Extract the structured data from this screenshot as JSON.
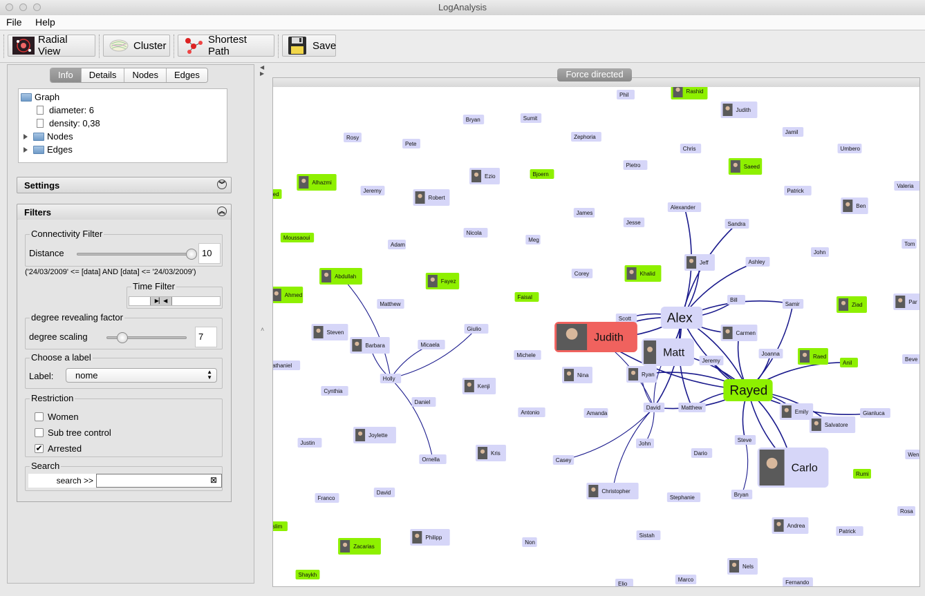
{
  "window": {
    "title": "LogAnalysis"
  },
  "menu": {
    "file": "File",
    "help": "Help"
  },
  "toolbar": {
    "radial_view": "Radial View",
    "cluster": "Cluster",
    "shortest_path": "Shortest Path",
    "save": "Save"
  },
  "tabs": [
    "Info",
    "Details",
    "Nodes",
    "Edges"
  ],
  "tree": {
    "root": "Graph",
    "diameter": "diameter: 6",
    "density": "density: 0,38",
    "nodes": "Nodes",
    "edges": "Edges"
  },
  "settings": {
    "label": "Settings"
  },
  "filters": {
    "label": "Filters",
    "connectivity_title": "Connectivity Filter",
    "distance_label": "Distance",
    "distance_value": "10",
    "distance_fraction": 1.0,
    "date_expr": "('24/03/2009' <= [data] AND [data] <= '24/03/2009')",
    "time_filter_title": "Time Filter",
    "degree_title": "degree revealing factor",
    "degree_label": "degree scaling",
    "degree_value": "7",
    "degree_fraction": 0.2,
    "label_title": "Choose a label",
    "label_label": "Label:",
    "label_selected": "nome",
    "restriction_title": "Restriction",
    "women": "Women",
    "women_checked": false,
    "subtree": "Sub tree control",
    "subtree_checked": false,
    "arrested": "Arrested",
    "arrested_checked": true,
    "search_title": "Search",
    "search_label": "search >>",
    "search_value": ""
  },
  "canvas": {
    "tab": "Force directed"
  },
  "colors": {
    "node_default": "#d6d6f8",
    "node_arrested": "#8ef000",
    "node_selected": "#f0625e",
    "edge": "#1a1a8c"
  },
  "graph": {
    "nodes": [
      {
        "name": "Phil",
        "type": "plain"
      },
      {
        "name": "Rashid",
        "type": "arrested",
        "photo": true
      },
      {
        "name": "Judith",
        "type": "plain",
        "photo": true
      },
      {
        "name": "Bryan",
        "type": "plain"
      },
      {
        "name": "Sumit",
        "type": "plain"
      },
      {
        "name": "Zephoria",
        "type": "plain"
      },
      {
        "name": "Jamil",
        "type": "plain"
      },
      {
        "name": "Rosy",
        "type": "plain"
      },
      {
        "name": "Pete",
        "type": "plain"
      },
      {
        "name": "Chris",
        "type": "plain"
      },
      {
        "name": "Umbero",
        "type": "plain"
      },
      {
        "name": "Pietro",
        "type": "plain"
      },
      {
        "name": "Saeed",
        "type": "arrested",
        "photo": true
      },
      {
        "name": "Ezio",
        "type": "plain",
        "photo": true
      },
      {
        "name": "Bjoern",
        "type": "arrested"
      },
      {
        "name": "Alhazmi",
        "type": "arrested",
        "photo": true
      },
      {
        "name": "Jeremy",
        "type": "plain"
      },
      {
        "name": "Robert",
        "type": "plain",
        "photo": true
      },
      {
        "name": "Patrick",
        "type": "plain"
      },
      {
        "name": "Valeria",
        "type": "plain"
      },
      {
        "name": "Ben",
        "type": "plain",
        "photo": true
      },
      {
        "name": "Alexander",
        "type": "plain"
      },
      {
        "name": "James",
        "type": "plain"
      },
      {
        "name": "Jesse",
        "type": "plain"
      },
      {
        "name": "Sandra",
        "type": "plain"
      },
      {
        "name": "Moussaoui",
        "type": "arrested"
      },
      {
        "name": "Nicola",
        "type": "plain"
      },
      {
        "name": "Meg",
        "type": "plain"
      },
      {
        "name": "Adam",
        "type": "plain"
      },
      {
        "name": "Tom",
        "type": "plain"
      },
      {
        "name": "John",
        "type": "plain"
      },
      {
        "name": "Jeff",
        "type": "plain",
        "photo": true
      },
      {
        "name": "Ashley",
        "type": "plain"
      },
      {
        "name": "Abdullah",
        "type": "arrested",
        "photo": true
      },
      {
        "name": "Fayez",
        "type": "arrested",
        "photo": true
      },
      {
        "name": "Corey",
        "type": "plain"
      },
      {
        "name": "Khalid",
        "type": "arrested",
        "photo": true
      },
      {
        "name": "Ahmed",
        "type": "arrested",
        "photo": true
      },
      {
        "name": "Matthew",
        "type": "plain"
      },
      {
        "name": "Faisal",
        "type": "arrested"
      },
      {
        "name": "Bill",
        "type": "plain"
      },
      {
        "name": "Samir",
        "type": "plain"
      },
      {
        "name": "Ziad",
        "type": "arrested",
        "photo": true
      },
      {
        "name": "Scott",
        "type": "plain"
      },
      {
        "name": "Alex",
        "type": "plain",
        "big": true
      },
      {
        "name": "Steven",
        "type": "plain",
        "photo": true
      },
      {
        "name": "Giulio",
        "type": "plain"
      },
      {
        "name": "Barbara",
        "type": "plain",
        "photo": true
      },
      {
        "name": "Micaela",
        "type": "plain"
      },
      {
        "name": "Judith",
        "type": "selected",
        "photo": true,
        "big": true
      },
      {
        "name": "Carmen",
        "type": "plain",
        "photo": true
      },
      {
        "name": "Matt",
        "type": "plain",
        "photo": true,
        "big": true
      },
      {
        "name": "Joanna",
        "type": "plain"
      },
      {
        "name": "Raed",
        "type": "arrested",
        "photo": true
      },
      {
        "name": "Michele",
        "type": "plain"
      },
      {
        "name": "Jeremy",
        "type": "plain"
      },
      {
        "name": "Anil",
        "type": "arrested"
      },
      {
        "name": "Nathaniel",
        "type": "plain"
      },
      {
        "name": "Holly",
        "type": "plain"
      },
      {
        "name": "Nina",
        "type": "plain",
        "photo": true
      },
      {
        "name": "Ryan",
        "type": "plain",
        "photo": true
      },
      {
        "name": "Rayed",
        "type": "arrested",
        "big": true
      },
      {
        "name": "Kenji",
        "type": "plain",
        "photo": true
      },
      {
        "name": "Cynthia",
        "type": "plain"
      },
      {
        "name": "Daniel",
        "type": "plain"
      },
      {
        "name": "David",
        "type": "plain"
      },
      {
        "name": "Matthew",
        "type": "plain"
      },
      {
        "name": "Emily",
        "type": "plain",
        "photo": true
      },
      {
        "name": "Gianluca",
        "type": "plain"
      },
      {
        "name": "Antonio",
        "type": "plain"
      },
      {
        "name": "Amanda",
        "type": "plain"
      },
      {
        "name": "Salvatore",
        "type": "plain",
        "photo": true
      },
      {
        "name": "Joylette",
        "type": "plain",
        "photo": true
      },
      {
        "name": "Justin",
        "type": "plain"
      },
      {
        "name": "Steve",
        "type": "plain"
      },
      {
        "name": "Kris",
        "type": "plain",
        "photo": true
      },
      {
        "name": "Ornella",
        "type": "plain"
      },
      {
        "name": "John",
        "type": "plain"
      },
      {
        "name": "Casey",
        "type": "plain"
      },
      {
        "name": "Dario",
        "type": "plain"
      },
      {
        "name": "Carlo",
        "type": "plain",
        "photo": true,
        "big": true
      },
      {
        "name": "Rumi",
        "type": "arrested"
      },
      {
        "name": "Franco",
        "type": "plain"
      },
      {
        "name": "David",
        "type": "plain"
      },
      {
        "name": "Christopher",
        "type": "plain",
        "photo": true
      },
      {
        "name": "Stephanie",
        "type": "plain"
      },
      {
        "name": "Bryan",
        "type": "plain"
      },
      {
        "name": "Rosa",
        "type": "plain"
      },
      {
        "name": "Andrea",
        "type": "plain",
        "photo": true
      },
      {
        "name": "Patrick",
        "type": "plain"
      },
      {
        "name": "Philipp",
        "type": "plain",
        "photo": true
      },
      {
        "name": "Sistah",
        "type": "plain"
      },
      {
        "name": "Zacarias",
        "type": "arrested",
        "photo": true
      },
      {
        "name": "Non",
        "type": "plain"
      },
      {
        "name": "Nels",
        "type": "plain",
        "photo": true
      },
      {
        "name": "Shaykh",
        "type": "arrested"
      },
      {
        "name": "Marco",
        "type": "plain"
      },
      {
        "name": "Fernando",
        "type": "plain"
      },
      {
        "name": "Wen",
        "type": "plain"
      },
      {
        "name": "Beve",
        "type": "plain"
      },
      {
        "name": "Par",
        "type": "plain",
        "photo": true
      },
      {
        "name": "Elio",
        "type": "plain"
      },
      {
        "name": "athaniel",
        "type": "plain"
      },
      {
        "name": "slim",
        "type": "arrested"
      },
      {
        "name": "ed",
        "type": "arrested"
      }
    ]
  }
}
